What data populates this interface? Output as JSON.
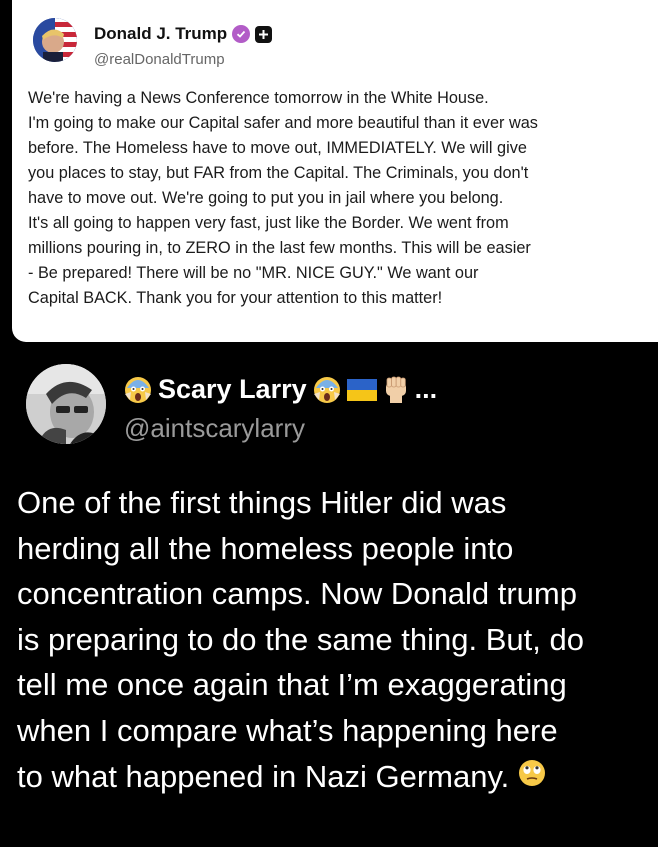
{
  "original_post": {
    "display_name": "Donald J. Trump",
    "handle": "@realDonaldTrump",
    "verified_icon": "verified-badge-icon",
    "body_lines": [
      "We're having a News Conference tomorrow in the White House.",
      "I'm going to make our Capital safer and more beautiful than it ever was",
      "before. The Homeless have to move out, IMMEDIATELY. We will give",
      "you places to stay, but FAR from the Capital. The Criminals, you don't",
      "have to move out. We're going to put you in jail where you belong.",
      "It's all going to happen very fast, just like the Border. We went from",
      "millions pouring in, to ZERO in the  last few months. This will be easier",
      "- Be prepared! There will be no \"MR. NICE GUY.\" We want our",
      "Capital BACK. Thank you for your attention to this matter!"
    ]
  },
  "reply_post": {
    "display_name": "Scary Larry",
    "handle": "@aintscarylarry",
    "more_label": "...",
    "body_lines": [
      "One of the first things Hitler did was",
      "herding all the homeless people into",
      "concentration camps. Now Donald trump",
      "is preparing to do the same thing. But, do",
      "tell me once again that I’m exaggerating",
      "when I compare what’s happening here",
      "to what happened in Nazi Germany."
    ]
  },
  "colors": {
    "background": "#000000",
    "card": "#ffffff",
    "verified_badge": "#b25cc7",
    "handle_gray": "#9a9a9a"
  }
}
